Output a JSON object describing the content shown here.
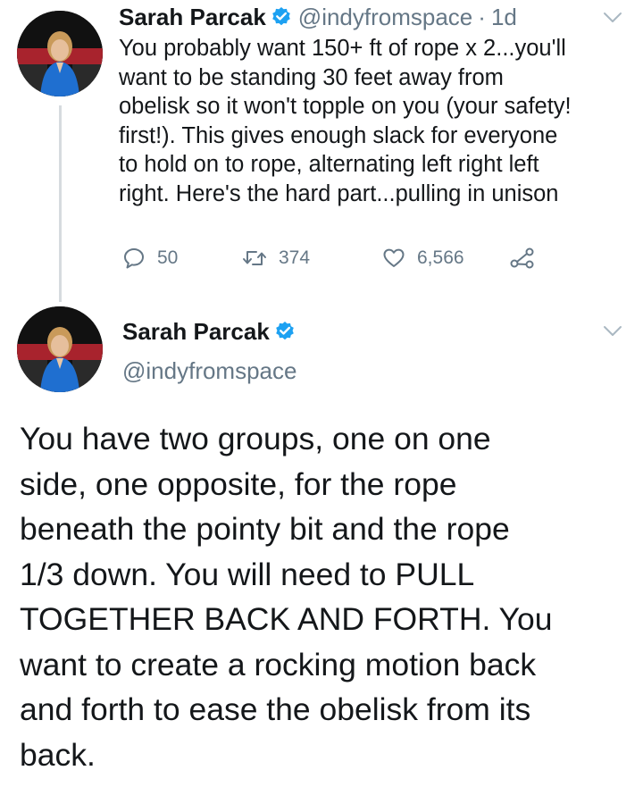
{
  "tweet1": {
    "author_name": "Sarah Parcak",
    "handle": "@indyfromspace",
    "separator": "·",
    "time": "1d",
    "text_lines": [
      "You probably want 150+ ft of rope x 2...you'll",
      "want to be standing 30 feet away from",
      "obelisk so it won't topple on you (your safety!",
      "first!). This gives enough slack for everyone",
      "to hold on to rope, alternating left right left",
      "right. Here's the hard part...pulling in unison"
    ],
    "reply_count": "50",
    "retweet_count": "374",
    "like_count": "6,566"
  },
  "tweet2": {
    "author_name": "Sarah Parcak",
    "handle": "@indyfromspace",
    "text_lines": [
      "You have two groups, one on one",
      "side, one opposite, for the rope",
      "beneath the pointy bit and the rope",
      "1/3 down. You will need to PULL",
      "TOGETHER BACK AND FORTH. You",
      "want to create a rocking motion back",
      "and forth to ease the obelisk from its",
      "back."
    ]
  },
  "icons": {
    "verified": "verified-badge-icon",
    "reply": "reply-icon",
    "retweet": "retweet-icon",
    "like": "heart-icon",
    "share": "share-icon",
    "menu": "chevron-down-icon"
  },
  "colors": {
    "verified_blue": "#1da1f2",
    "secondary_text": "#657786",
    "primary_text": "#14171a",
    "thread_line": "#d6dbdf"
  }
}
